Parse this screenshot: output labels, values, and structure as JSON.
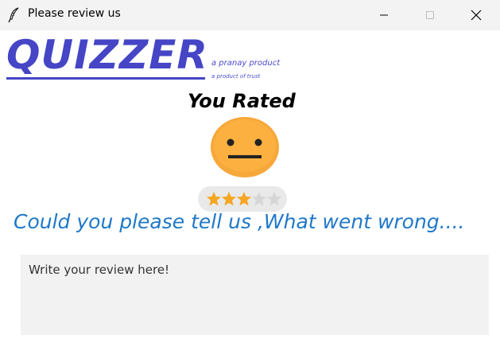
{
  "window": {
    "title": "Please review us",
    "icon": "feather-icon"
  },
  "brand": {
    "logo": "QUIZZER",
    "tagline": "a pranay product",
    "subtagline": "a product of trust",
    "color": "#4545c6"
  },
  "rating": {
    "heading": "You Rated",
    "emoji": "neutral-face",
    "stars": 3,
    "max_stars": 5,
    "star_color": "#f5a623"
  },
  "feedback": {
    "question": "Could you please tell us ,What went wrong....",
    "question_color": "#1f78c8",
    "placeholder": "Write your review here!"
  }
}
